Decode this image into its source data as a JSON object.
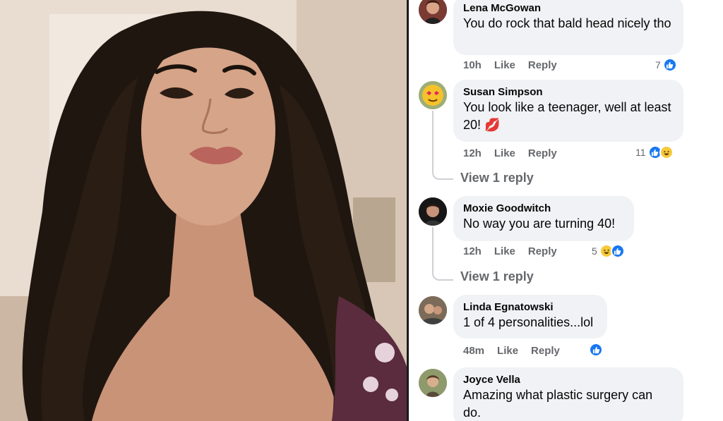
{
  "photo": {
    "alt": ""
  },
  "comments": [
    {
      "author": "Lena McGowan",
      "text": "You do rock that bald head nicely tho",
      "time": "10h",
      "like": "Like",
      "reply": "Reply",
      "reaction_count": "7",
      "reactions": [
        "like"
      ]
    },
    {
      "author": "Susan Simpson",
      "text": "You look like a teenager, well at least 20! 💋",
      "time": "12h",
      "like": "Like",
      "reply": "Reply",
      "reaction_count": "11",
      "reactions": [
        "like",
        "haha"
      ],
      "view_replies": "View 1 reply"
    },
    {
      "author": "Moxie Goodwitch",
      "text": "No way you are turning 40!",
      "time": "12h",
      "like": "Like",
      "reply": "Reply",
      "reaction_count": "5",
      "reactions": [
        "haha",
        "like"
      ],
      "view_replies": "View 1 reply"
    },
    {
      "author": "Linda Egnatowski",
      "text": "1 of 4 personalities...lol",
      "time": "48m",
      "like": "Like",
      "reply": "Reply",
      "reaction_count": "",
      "reactions": [
        "like"
      ]
    },
    {
      "author": "Joyce Vella",
      "text": "Amazing what plastic surgery can do.",
      "time": "",
      "like": "",
      "reply": "",
      "reaction_count": "",
      "reactions": []
    }
  ],
  "colors": {
    "like_blue": "#1877f2",
    "bubble_bg": "#f0f2f5",
    "meta_gray": "#65676b"
  }
}
